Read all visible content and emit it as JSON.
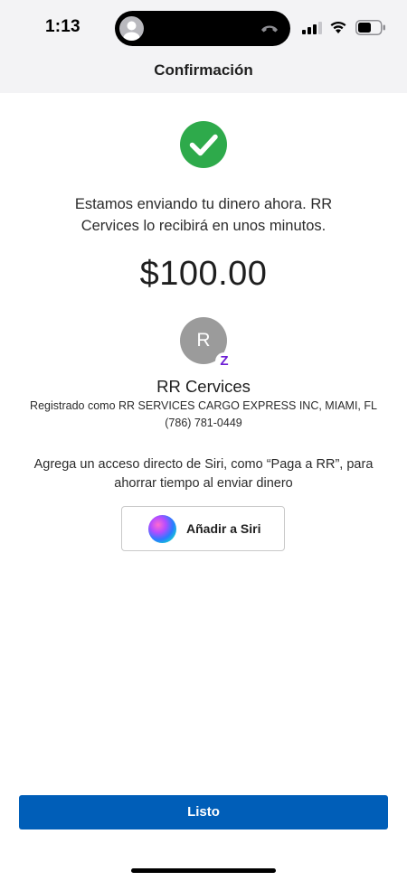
{
  "status_bar": {
    "time": "1:13"
  },
  "header": {
    "title": "Confirmación"
  },
  "confirmation": {
    "message": "Estamos enviando tu dinero ahora. RR Cervices lo recibirá en unos minutos.",
    "amount": "$100.00"
  },
  "recipient": {
    "initial": "R",
    "badge": "Z",
    "name": "RR Cervices",
    "registered": "Registrado como RR SERVICES CARGO EXPRESS INC, MIAMI, FL",
    "phone": "(786) 781-0449"
  },
  "siri": {
    "prompt": "Agrega un acceso directo de Siri, como “Paga a RR”, para ahorrar tiempo al enviar dinero",
    "button_label": "Añadir a Siri"
  },
  "footer": {
    "done_label": "Listo"
  },
  "colors": {
    "success_green": "#2eaa4b",
    "primary_blue": "#005eb8",
    "zelle_purple": "#6d1ed4"
  }
}
